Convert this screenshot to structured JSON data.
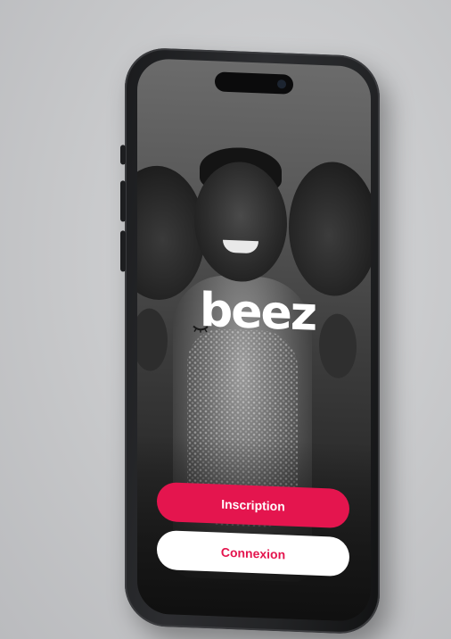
{
  "app": {
    "logo_text": "beez",
    "brand_color": "#e4154e",
    "logo_icon": "closed-eye-icon"
  },
  "actions": {
    "signup_label": "Inscription",
    "login_label": "Connexion"
  },
  "hero": {
    "image_description_icon": "photo-three-women"
  }
}
